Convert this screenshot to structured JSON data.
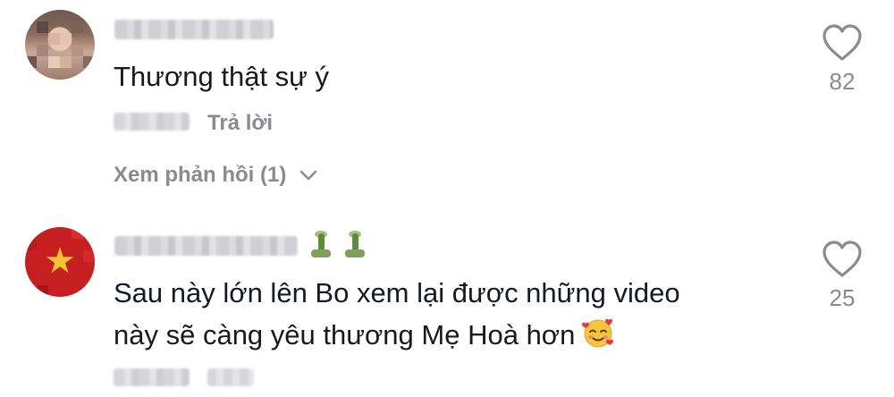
{
  "comments": [
    {
      "text": "Thương thật sự ý",
      "reply_label": "Trả lời",
      "view_replies_label": "Xem phản hồi (1)",
      "like_count": "82",
      "avatar_icon": "user-photo-avatar"
    },
    {
      "text_line1": "Sau này lớn lên Bo xem lại được những video",
      "text_line2": "này sẽ càng yêu thương Mẹ Hoà hơn",
      "emoji_icon": "smiling-face-with-hearts",
      "like_count": "25",
      "avatar_icon": "vietnam-flag-avatar"
    }
  ]
}
